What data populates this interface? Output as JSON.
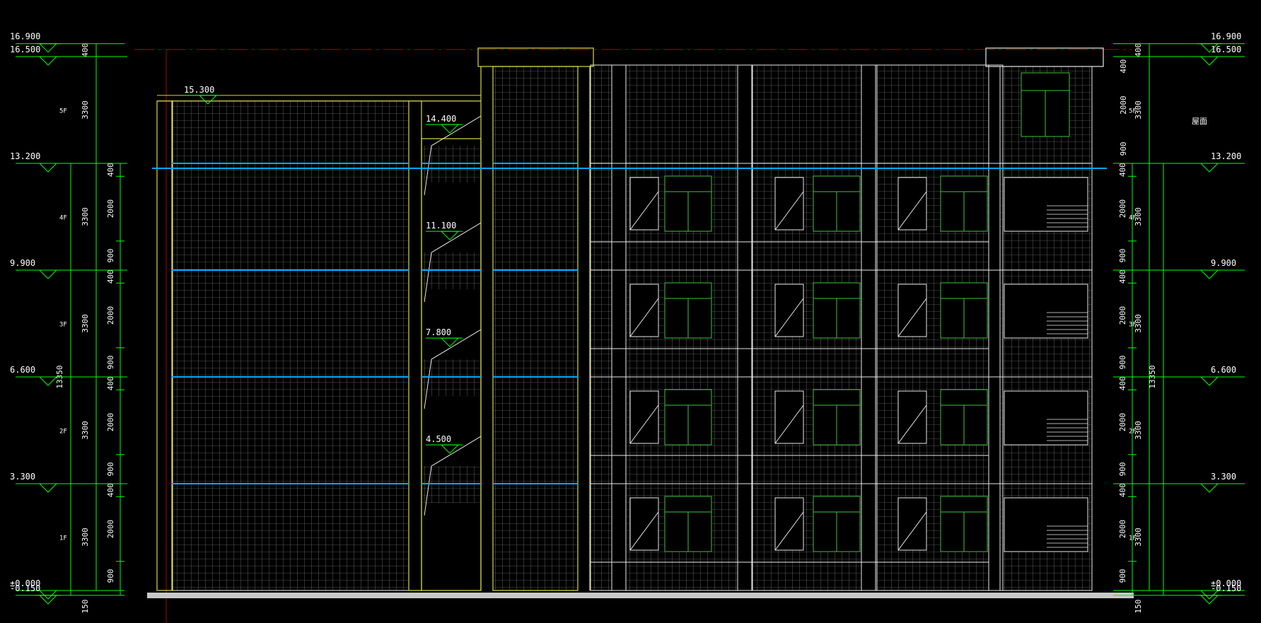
{
  "colors": {
    "background": "#000000",
    "dim_line": "#00ff00",
    "outline": "#e8e8e8",
    "grid": "#9a9a9a",
    "stair": "#d8d840",
    "slab": "#00aaff",
    "window": "#40c040",
    "ground": "#c8c8c8",
    "axis": "#b00000",
    "text": "#ffffff"
  },
  "levels": [
    {
      "label": "16.900",
      "value": 16.9
    },
    {
      "label": "16.500",
      "value": 16.5
    },
    {
      "label": "13.200",
      "value": 13.2
    },
    {
      "label": "9.900",
      "value": 9.9
    },
    {
      "label": "6.600",
      "value": 6.6
    },
    {
      "label": "3.300",
      "value": 3.3
    },
    {
      "label": "±0.000",
      "value": 0.0
    },
    {
      "label": "-0.150",
      "value": -0.15
    }
  ],
  "floors": [
    {
      "label": "1F",
      "bottom": 0.0,
      "top": 3.3
    },
    {
      "label": "2F",
      "bottom": 3.3,
      "top": 6.6
    },
    {
      "label": "3F",
      "bottom": 6.6,
      "top": 9.9
    },
    {
      "label": "4F",
      "bottom": 9.9,
      "top": 13.2
    },
    {
      "label": "5F",
      "bottom": 13.2,
      "top": 16.5
    }
  ],
  "left_chain": {
    "top_labels": [
      "400",
      "3300"
    ],
    "floor_parts": [
      "900",
      "2000",
      "400"
    ],
    "floor_total": "3300",
    "overall": "13350",
    "base": "150"
  },
  "right_chain": {
    "top_labels": [
      "400",
      "400",
      "2000",
      "900"
    ],
    "top_total": "3300",
    "floor_parts": [
      "900",
      "2000",
      "400"
    ],
    "floor_total": "3300",
    "overall": "13350",
    "base": "150",
    "roof_note": "屋面"
  },
  "stair_levels": [
    {
      "label": "15.300",
      "value": 15.3
    },
    {
      "label": "14.400",
      "value": 14.4
    },
    {
      "label": "11.100",
      "value": 11.1
    },
    {
      "label": "7.800",
      "value": 7.8
    },
    {
      "label": "4.500",
      "value": 4.5
    }
  ]
}
